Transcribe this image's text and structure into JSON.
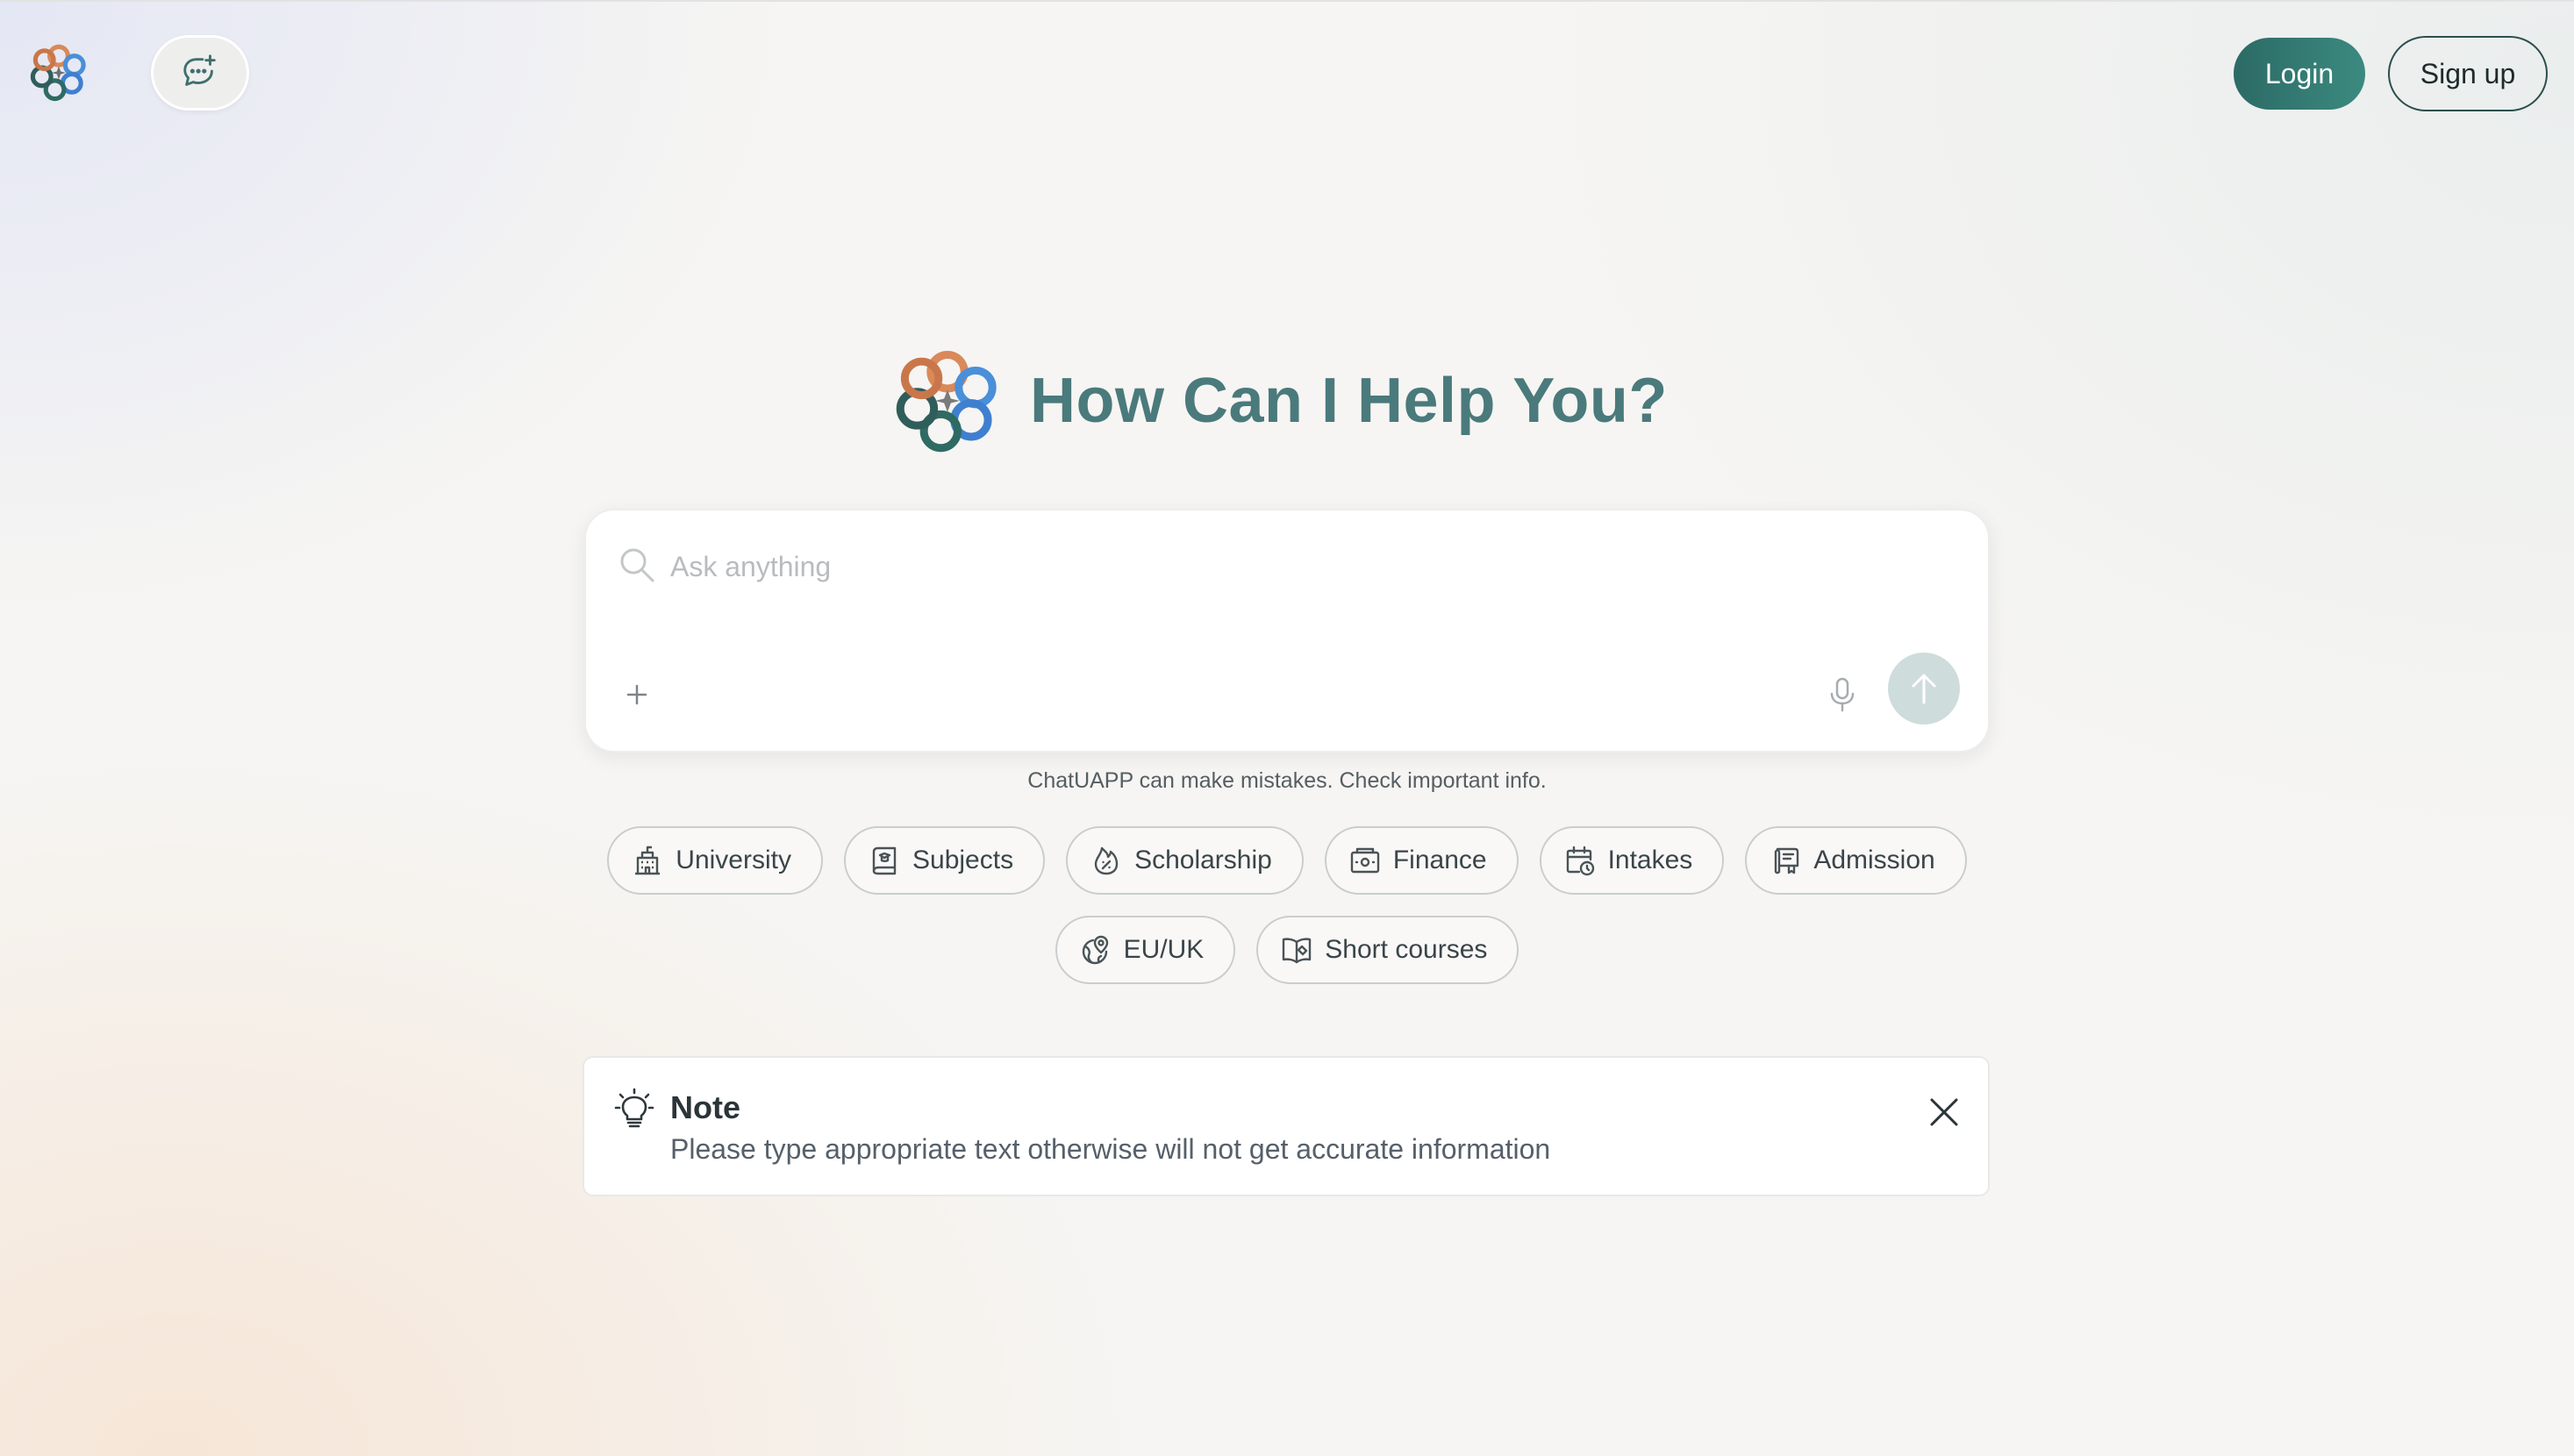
{
  "header": {
    "login_label": "Login",
    "signup_label": "Sign up"
  },
  "hero": {
    "title": "How Can I Help You?"
  },
  "search": {
    "placeholder": "Ask anything",
    "disclaimer": "ChatUAPP can make mistakes. Check important info."
  },
  "chips": {
    "row1": [
      {
        "label": "University",
        "icon": "building-icon"
      },
      {
        "label": "Subjects",
        "icon": "book-icon"
      },
      {
        "label": "Scholarship",
        "icon": "money-flame-icon"
      },
      {
        "label": "Finance",
        "icon": "wallet-icon"
      },
      {
        "label": "Intakes",
        "icon": "calendar-clock-icon"
      },
      {
        "label": "Admission",
        "icon": "diploma-icon"
      }
    ],
    "row2": [
      {
        "label": "EU/UK",
        "icon": "globe-pin-icon"
      },
      {
        "label": "Short courses",
        "icon": "open-book-icon"
      }
    ]
  },
  "note": {
    "title": "Note",
    "text": "Please type appropriate text otherwise will not get accurate information"
  },
  "colors": {
    "accent": "#4a7a7b",
    "login_bg": "#2c6a66",
    "send_bg": "#cfdcdc"
  }
}
